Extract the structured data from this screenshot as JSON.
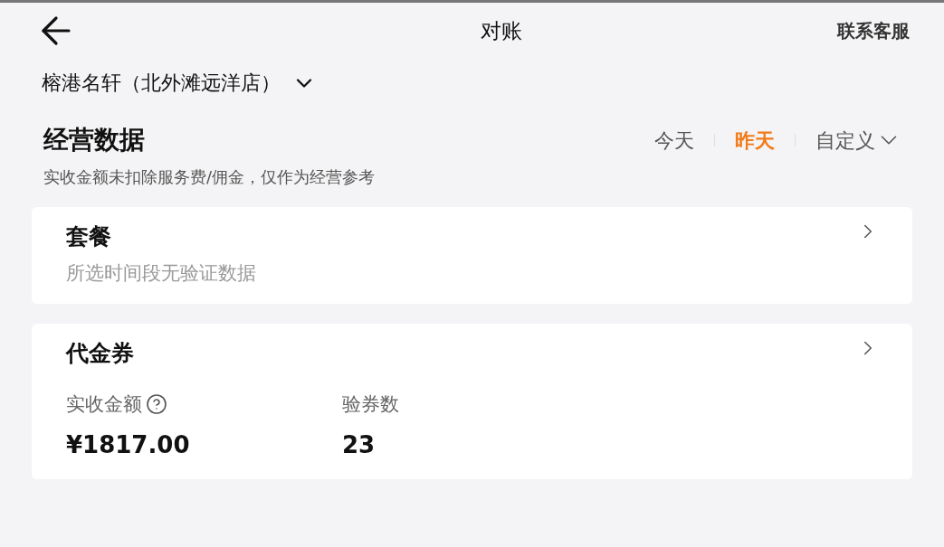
{
  "header": {
    "title": "对账",
    "action": "联系客服"
  },
  "store": {
    "name": "榕港名轩（北外滩远洋店）"
  },
  "section": {
    "title": "经营数据",
    "note": "实收金额未扣除服务费/佣金，仅作为经营参考",
    "periods": [
      {
        "label": "今天",
        "selected": false,
        "dropdown": false
      },
      {
        "label": "昨天",
        "selected": true,
        "dropdown": false
      },
      {
        "label": "自定义",
        "selected": false,
        "dropdown": true
      }
    ]
  },
  "cards": [
    {
      "title": "套餐",
      "kind": "empty",
      "message": "所选时间段无验证数据"
    },
    {
      "title": "代金券",
      "kind": "metrics",
      "metrics": [
        {
          "label": "实收金额",
          "help": true,
          "value": "¥1817.00"
        },
        {
          "label": "验券数",
          "help": false,
          "value": "23"
        }
      ]
    }
  ]
}
